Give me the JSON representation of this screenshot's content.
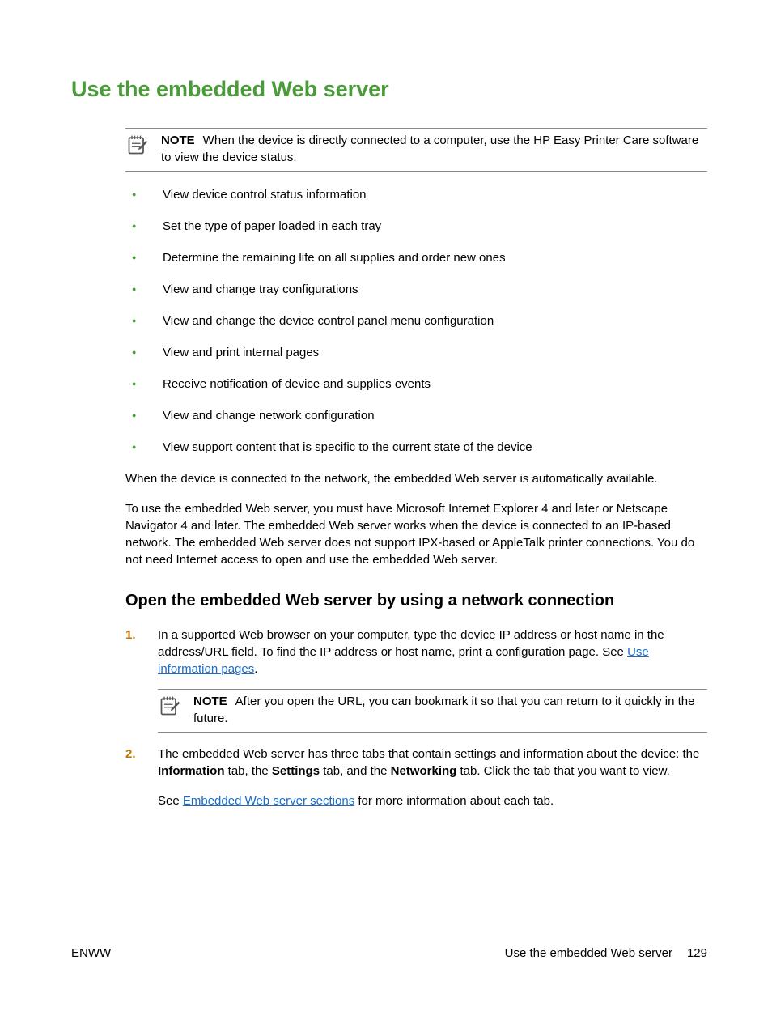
{
  "heading": "Use the embedded Web server",
  "note1": {
    "label": "NOTE",
    "text": "When the device is directly connected to a computer, use the HP Easy Printer Care software to view the device status."
  },
  "bullets": [
    "View device control status information",
    "Set the type of paper loaded in each tray",
    "Determine the remaining life on all supplies and order new ones",
    "View and change tray configurations",
    "View and change the device control panel menu configuration",
    "View and print internal pages",
    "Receive notification of device and supplies events",
    "View and change network configuration",
    "View support content that is specific to the current state of the device"
  ],
  "para1": "When the device is connected to the network, the embedded Web server is automatically available.",
  "para2": "To use the embedded Web server, you must have Microsoft Internet Explorer 4 and later or Netscape Navigator 4 and later. The embedded Web server works when the device is connected to an IP-based network. The embedded Web server does not support IPX-based or AppleTalk printer connections. You do not need Internet access to open and use the embedded Web server.",
  "subheading": "Open the embedded Web server by using a network connection",
  "step1": {
    "num": "1.",
    "text_before": "In a supported Web browser on your computer, type the device IP address or host name in the address/URL field. To find the IP address or host name, print a configuration page. See ",
    "link": "Use information pages",
    "text_after": "."
  },
  "note2": {
    "label": "NOTE",
    "text": "After you open the URL, you can bookmark it so that you can return to it quickly in the future."
  },
  "step2": {
    "num": "2.",
    "pre": "The embedded Web server has three tabs that contain settings and information about the device: the ",
    "tab1": "Information",
    "mid1": " tab, the ",
    "tab2": "Settings",
    "mid2": " tab, and the ",
    "tab3": "Networking",
    "post": " tab. Click the tab that you want to view.",
    "para2_pre": "See ",
    "para2_link": "Embedded Web server sections",
    "para2_post": " for more information about each tab."
  },
  "footer": {
    "left": "ENWW",
    "right_text": "Use the embedded Web server",
    "page": "129"
  }
}
